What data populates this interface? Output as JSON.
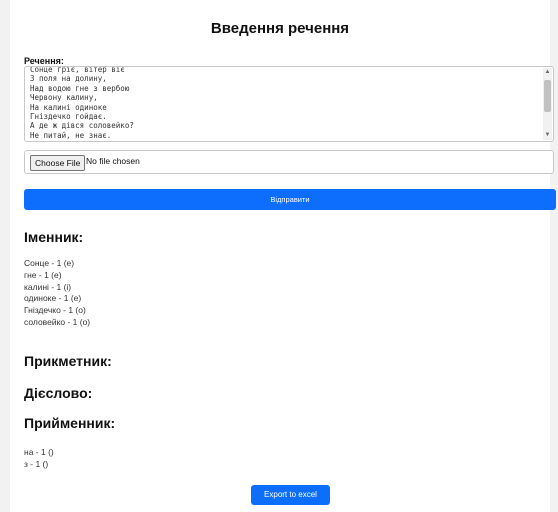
{
  "page": {
    "title": "Введення речення"
  },
  "form": {
    "sentence_label": "Речення:",
    "textarea_value": "Сонце гріє, вітер віє\nЗ поля на долину,\nНад водою гне з вербою\nЧервону калину,\nНа калині одиноке\nГніздечко гойдає.\nА де ж дівся соловейко?\nНе питай, не знає.",
    "file_button_label": "Choose File",
    "file_status": "No file chosen",
    "submit_label": "Відправити"
  },
  "results": {
    "noun_heading": "Іменник:",
    "nouns": [
      "Сонце - 1 (е)",
      "гне - 1 (е)",
      "калині - 1 (і)",
      "одиноке - 1 (е)",
      "Гніздечко - 1 (о)",
      "соловейко - 1 (о)"
    ],
    "adjective_heading": "Прикметник:",
    "verb_heading": "Дієслово:",
    "preposition_heading": "Прийменник:",
    "prepositions": [
      "на - 1 ()",
      "з - 1 ()"
    ]
  },
  "actions": {
    "export_label": "Export to excel"
  }
}
